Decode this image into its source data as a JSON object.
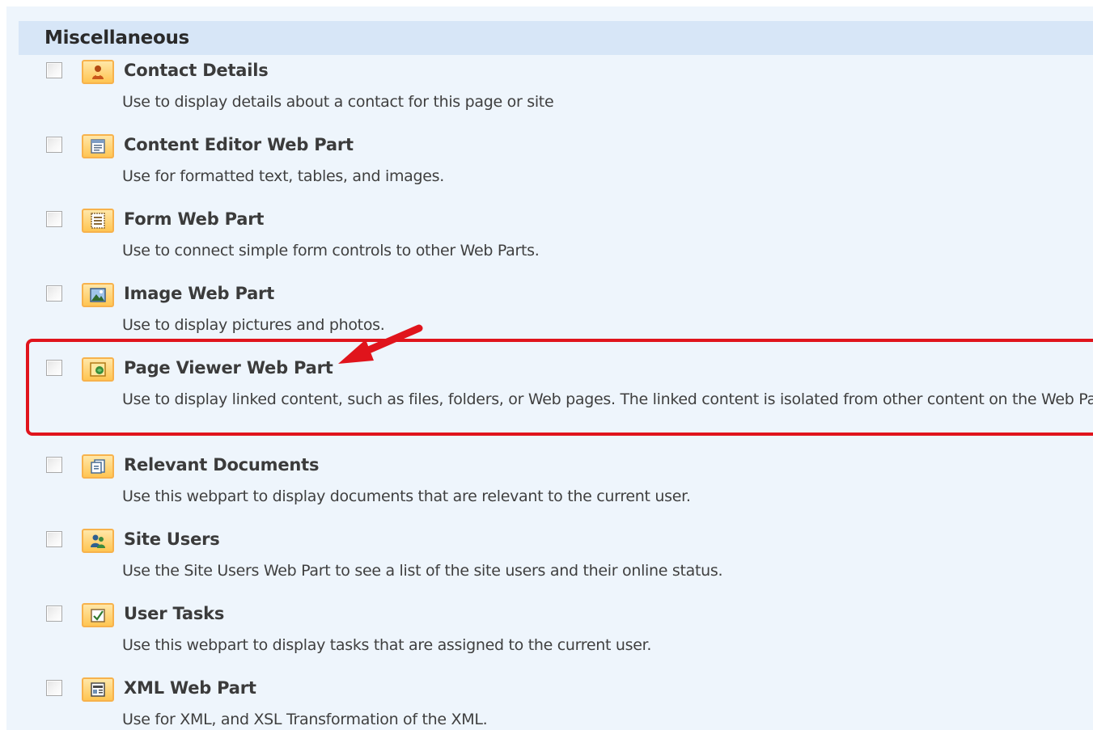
{
  "section": {
    "title": "Miscellaneous"
  },
  "items": [
    {
      "title": "Contact Details",
      "description": "Use to display details about a contact for this page or site",
      "icon": "contact-card-icon"
    },
    {
      "title": "Content Editor Web Part",
      "description": "Use for formatted text, tables, and images.",
      "icon": "content-editor-icon"
    },
    {
      "title": "Form Web Part",
      "description": "Use to connect simple form controls to other Web Parts.",
      "icon": "form-icon"
    },
    {
      "title": "Image Web Part",
      "description": "Use to display pictures and photos.",
      "icon": "image-icon"
    },
    {
      "title": "Page Viewer Web Part",
      "description": "Use to display linked content, such as files, folders, or Web pages. The linked content is isolated from other content on the Web Page.",
      "icon": "page-viewer-icon"
    },
    {
      "title": "Relevant Documents",
      "description": "Use this webpart to display documents that are relevant to the current user.",
      "icon": "documents-icon"
    },
    {
      "title": "Site Users",
      "description": "Use the Site Users Web Part to see a list of the site users and their online status.",
      "icon": "site-users-icon"
    },
    {
      "title": "User Tasks",
      "description": "Use this webpart to display tasks that are assigned to the current user.",
      "icon": "tasks-icon"
    },
    {
      "title": "XML Web Part",
      "description": "Use for XML, and XSL Transformation of the XML.",
      "icon": "xml-icon"
    }
  ],
  "colors": {
    "panel_background": "#eef5fc",
    "header_background": "#d7e6f7",
    "highlight": "#e0141c",
    "icon_border": "#f7b24c"
  }
}
